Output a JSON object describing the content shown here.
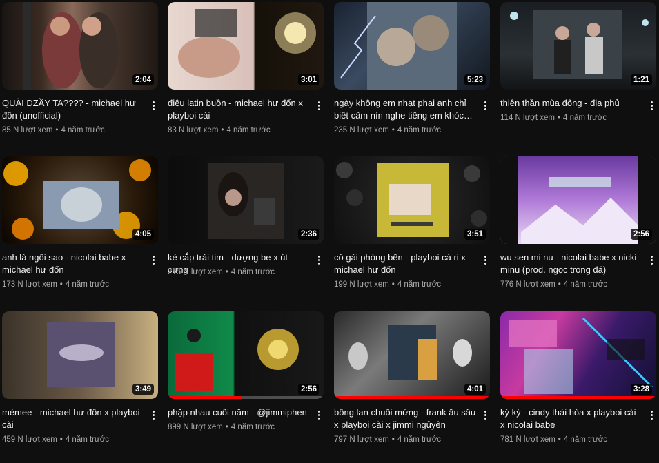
{
  "colors": {
    "background": "#0f0f0f",
    "text": "#f1f1f1",
    "meta": "#aaaaaa",
    "progress": "#ff0000"
  },
  "icons": {
    "more": "more-vert-icon"
  },
  "videos": [
    {
      "title": "QUÀI DZẦY TA???? - michael hư đốn (unofficial)",
      "views": "85 N lượt xem",
      "age": "4 năm trước",
      "duration": "2:04"
    },
    {
      "title": "điệu latin buồn - michael hư đốn x playboi cài",
      "views": "83 N lượt xem",
      "age": "4 năm trước",
      "duration": "3:01"
    },
    {
      "title": "ngày không em nhạt phai anh chỉ biết câm nín nghe tiếng em khóc -...",
      "views": "235 N lượt xem",
      "age": "4 năm trước",
      "duration": "5:23"
    },
    {
      "title": "thiên thần mùa đông - địa phủ",
      "views": "114 N lượt xem",
      "age": "4 năm trước",
      "duration": "1:21"
    },
    {
      "title": "anh là ngôi sao - nicolai babe x michael hư đốn",
      "views": "173 N lượt xem",
      "age": "4 năm trước",
      "duration": "4:05"
    },
    {
      "title": "kẻ cắp trái tim - dượng be x út cưng",
      "views": "215 N lượt xem",
      "age": "4 năm trước",
      "duration": "2:36"
    },
    {
      "title": "cô gái phòng bên - playboi cà ri x michael hư đốn",
      "views": "199 N lượt xem",
      "age": "4 năm trước",
      "duration": "3:51"
    },
    {
      "title": "wu sen mi nu - nicolai babe x nicki minu (prod. ngọc trong đá)",
      "views": "776 N lượt xem",
      "age": "4 năm trước",
      "duration": "2:56"
    },
    {
      "title": "mémee - michael hư đốn x playboi cài",
      "views": "459 N lượt xem",
      "age": "4 năm trước",
      "duration": "3:49"
    },
    {
      "title": "phặp nhau cuối năm - @jimmiphen",
      "views": "899 N lượt xem",
      "age": "4 năm trước",
      "duration": "2:56",
      "progress": 0.48
    },
    {
      "title": "bông lan chuối mứng - frank âu sầu x playboi cài x jimmi ngủyên",
      "views": "797 N lượt xem",
      "age": "4 năm trước",
      "duration": "4:01",
      "progress": 1.0
    },
    {
      "title": "kỳ kỳ - cindy thái hòa x playboi cài x nicolai babe",
      "views": "781 N lượt xem",
      "age": "4 năm trước",
      "duration": "3:28",
      "progress": 1.0
    }
  ]
}
